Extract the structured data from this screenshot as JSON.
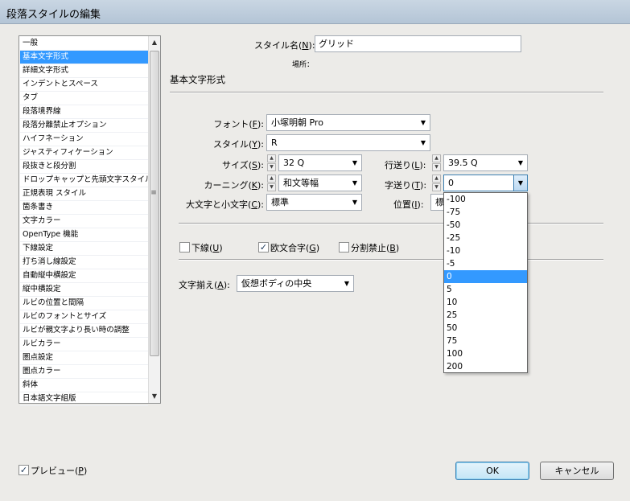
{
  "window": {
    "title": "段落スタイルの編集"
  },
  "categories": {
    "items": [
      "一般",
      "基本文字形式",
      "詳細文字形式",
      "インデントとスペース",
      "タブ",
      "段落境界線",
      "段落分離禁止オプション",
      "ハイフネーション",
      "ジャスティフィケーション",
      "段抜きと段分割",
      "ドロップキャップと先頭文字スタイル",
      "正規表現 スタイル",
      "箇条書き",
      "文字カラー",
      "OpenType 機能",
      "下線設定",
      "打ち消し線設定",
      "自動縦中横設定",
      "縦中横設定",
      "ルビの位置と間隔",
      "ルビのフォントとサイズ",
      "ルビが親文字より長い時の調整",
      "ルビカラー",
      "圏点設定",
      "圏点カラー",
      "斜体",
      "日本語文字組版"
    ],
    "selected_index": 1
  },
  "style_name": {
    "label": "スタイル名(",
    "key": "N",
    "suffix": "):",
    "value": "グリッド"
  },
  "location": {
    "label": "場所：",
    "value": ""
  },
  "section_title": "基本文字形式",
  "font": {
    "label": "フォント(",
    "key": "F",
    "suffix": "):",
    "value": "小塚明朝 Pro"
  },
  "style": {
    "label": "スタイル(",
    "key": "Y",
    "suffix": "):",
    "value": "R"
  },
  "size": {
    "label": "サイズ(",
    "key": "S",
    "suffix": "):",
    "value": "32 Q"
  },
  "leading": {
    "label": "行送り(",
    "key": "L",
    "suffix": "):",
    "value": "39.5 Q"
  },
  "kerning": {
    "label": "カーニング(",
    "key": "K",
    "suffix": "):",
    "value": "和文等幅"
  },
  "tracking": {
    "label": "字送り(",
    "key": "T",
    "suffix": "):",
    "value": "0"
  },
  "case": {
    "label": "大文字と小文字(",
    "key": "C",
    "suffix": "):",
    "value": "標準"
  },
  "position": {
    "label": "位置(",
    "key": "I",
    "suffix": "):",
    "value": "標"
  },
  "underline": {
    "label": "下線(",
    "key": "U",
    "suffix": ")",
    "checked": false
  },
  "ligatures": {
    "label": "欧文合字(",
    "key": "G",
    "suffix": ")",
    "checked": true
  },
  "no_break": {
    "label": "分割禁止(",
    "key": "B",
    "suffix": ")",
    "checked": false
  },
  "alignment": {
    "label": "文字揃え(",
    "key": "A",
    "suffix": "):",
    "value": "仮想ボディの中央"
  },
  "tracking_options": {
    "items": [
      "-100",
      "-75",
      "-50",
      "-25",
      "-10",
      "-5",
      "0",
      "5",
      "10",
      "25",
      "50",
      "75",
      "100",
      "200"
    ],
    "selected_index": 6
  },
  "preview": {
    "label": "プレビュー(",
    "key": "P",
    "suffix": ")",
    "checked": true
  },
  "buttons": {
    "ok": "OK",
    "cancel": "キャンセル"
  },
  "icons": {
    "check": "checkmark-icon",
    "arrow": "triangle-down-icon",
    "scroll_up": "scroll-up-icon",
    "scroll_down": "scroll-down-icon"
  }
}
